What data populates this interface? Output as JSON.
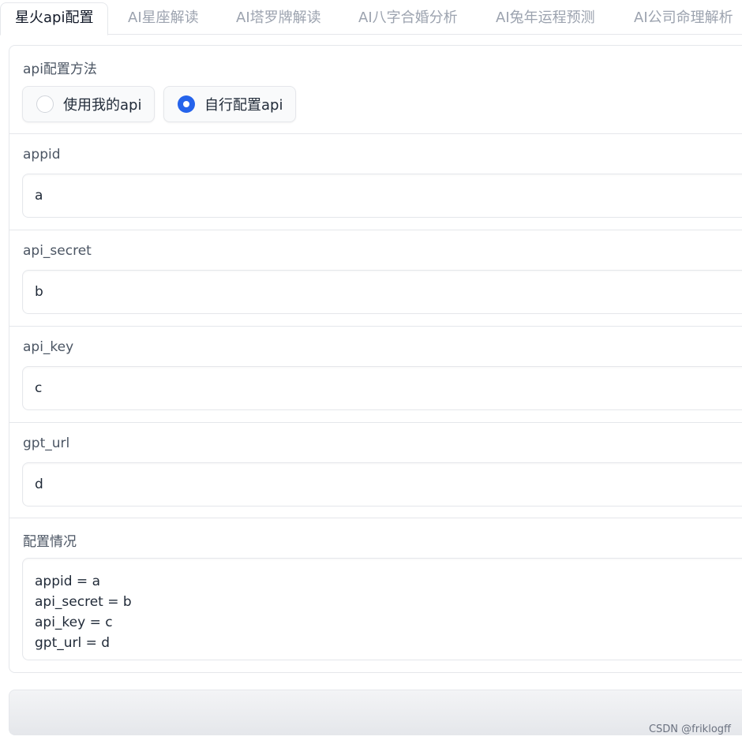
{
  "tabs": [
    {
      "label": "星火api配置",
      "active": true
    },
    {
      "label": "AI星座解读",
      "active": false
    },
    {
      "label": "AI塔罗牌解读",
      "active": false
    },
    {
      "label": "AI八字合婚分析",
      "active": false
    },
    {
      "label": "AI兔年运程预测",
      "active": false
    },
    {
      "label": "AI公司命理解析",
      "active": false
    }
  ],
  "config_method": {
    "label": "api配置方法",
    "options": [
      {
        "label": "使用我的api",
        "selected": false
      },
      {
        "label": "自行配置api",
        "selected": true
      }
    ]
  },
  "fields": {
    "appid": {
      "label": "appid",
      "value": "a"
    },
    "api_secret": {
      "label": "api_secret",
      "value": "b"
    },
    "api_key": {
      "label": "api_key",
      "value": "c"
    },
    "gpt_url": {
      "label": "gpt_url",
      "value": "d"
    }
  },
  "status": {
    "label": "配置情况",
    "lines": [
      "appid = a",
      "api_secret = b",
      "api_key = c",
      "gpt_url = d"
    ]
  },
  "watermark": "CSDN @friklogff",
  "colors": {
    "accent": "#2563eb",
    "border": "#e5e7eb",
    "muted_text": "#9ca3af"
  }
}
